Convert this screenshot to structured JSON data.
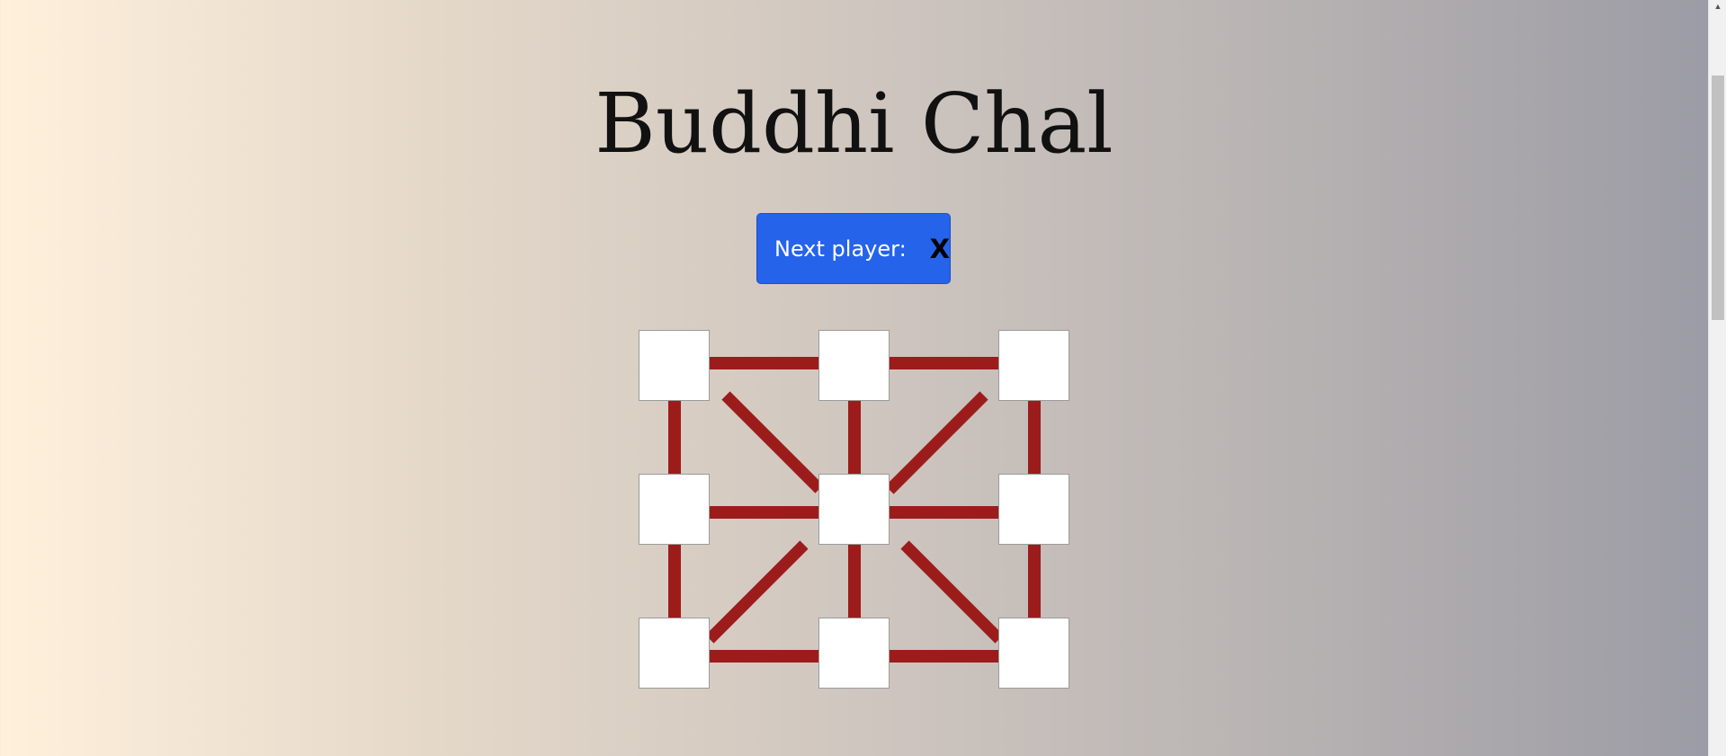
{
  "game": {
    "title": "Buddhi Chal",
    "status_label": "Next player:",
    "next_player": "X"
  },
  "board": {
    "rows": 3,
    "cols": 3,
    "cells": [
      "",
      "",
      "",
      "",
      "",
      "",
      "",
      "",
      ""
    ],
    "line_color": "#9c1c1c"
  },
  "colors": {
    "status_bg": "#2563eb",
    "cell_bg": "#ffffff"
  },
  "icons": {
    "scroll_up": "▲"
  }
}
